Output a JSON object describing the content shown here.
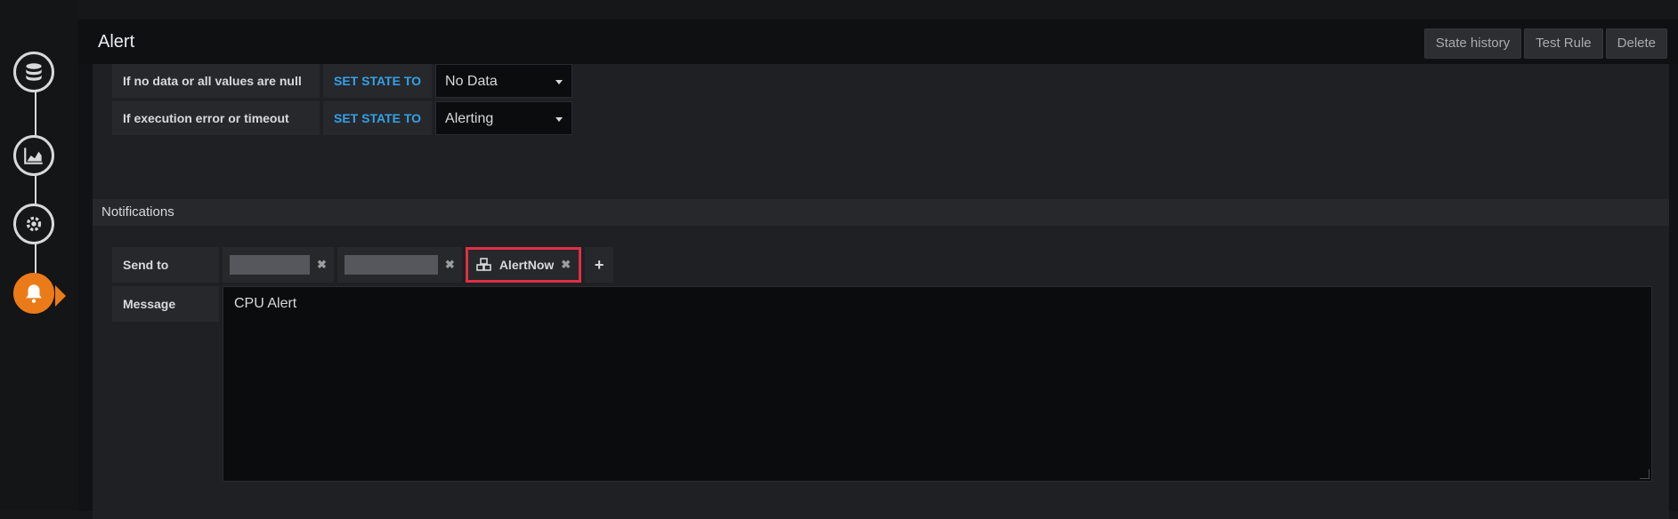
{
  "header": {
    "title": "Alert",
    "buttons": {
      "state_history": "State history",
      "test_rule": "Test Rule",
      "delete": "Delete"
    }
  },
  "rail": {
    "steps": [
      {
        "icon": "database-icon"
      },
      {
        "icon": "area-chart-icon"
      },
      {
        "icon": "cogs-icon"
      },
      {
        "icon": "bell-icon",
        "active": true
      }
    ]
  },
  "no_data_rules": [
    {
      "condition": "If no data or all values are null",
      "keyword": "SET STATE TO",
      "value": "No Data"
    },
    {
      "condition": "If execution error or timeout",
      "keyword": "SET STATE TO",
      "value": "Alerting"
    }
  ],
  "notifications": {
    "title": "Notifications",
    "send_to_label": "Send to",
    "channels": [
      {
        "name": "",
        "redacted": true
      },
      {
        "name": "",
        "redacted": true
      },
      {
        "name": "AlertNow",
        "redacted": false,
        "highlighted": true,
        "icon": "cubes-icon"
      }
    ],
    "message_label": "Message",
    "message": "CPU Alert"
  },
  "colors": {
    "accent": "#eb7b18",
    "keyword": "#33a2e5",
    "highlight": "#e02f44"
  }
}
